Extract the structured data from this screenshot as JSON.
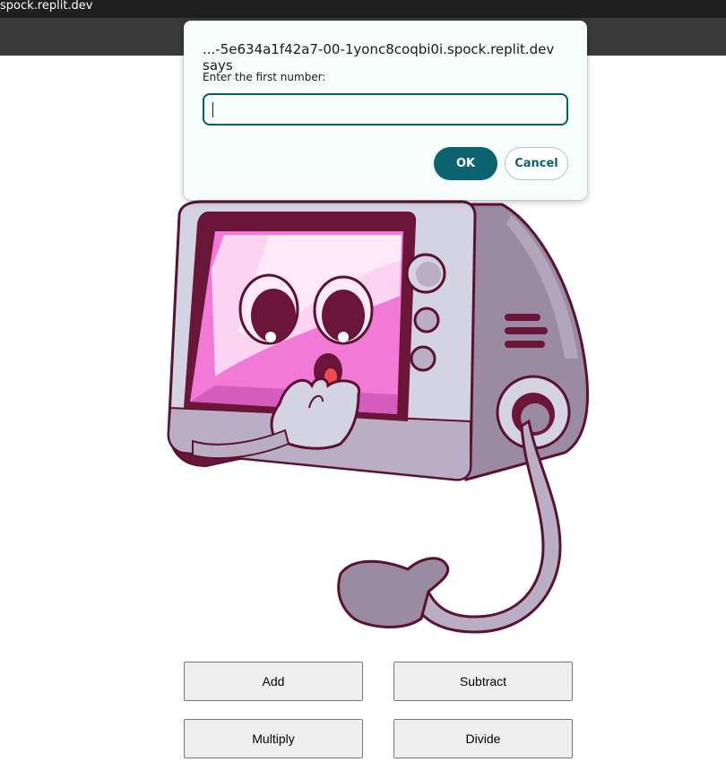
{
  "browser": {
    "url": "spock.replit.dev"
  },
  "dialog": {
    "title": "...-5e634a1f42a7-00-1yonc8coqbi0i.spock.replit.dev says",
    "message": "Enter the first number:",
    "input_value": "",
    "ok_label": "OK",
    "cancel_label": "Cancel"
  },
  "illustration": {
    "icon": "microwave-character-illustration"
  },
  "calculator": {
    "buttons": [
      "Add",
      "Subtract",
      "Multiply",
      "Divide"
    ]
  },
  "colors": {
    "dialog_background": "#f6fdfb",
    "accent": "#0b6370",
    "topbar": "#1f1f1f",
    "toolbar": "#3a3a3a",
    "button_background": "#efefef"
  }
}
